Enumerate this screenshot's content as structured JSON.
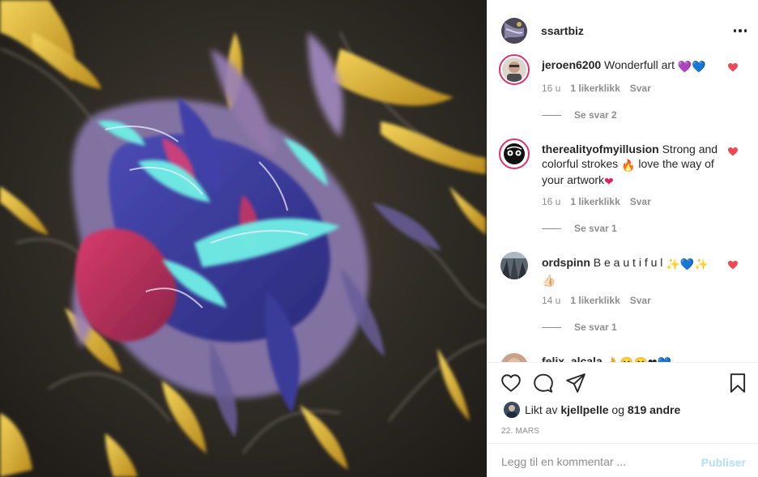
{
  "post": {
    "username": "ssartbiz"
  },
  "comments": [
    {
      "username": "jeroen6200",
      "text": " Wonderfull art ",
      "emojis": "💜💙",
      "time": "16 u",
      "likes": "1 likerklikk",
      "reply": "Svar",
      "replies_label": "Se svar 2"
    },
    {
      "username": "therealityofmyillusion",
      "text": " Strong and colorful strokes ",
      "emoji_mid": "🔥",
      "text2": " love the way of your artwork",
      "emoji_end": "❤",
      "time": "16 u",
      "likes": "1 likerklikk",
      "reply": "Svar",
      "replies_label": "Se svar 1"
    },
    {
      "username": "ordspinn",
      "text": " B e a u t i f u l ",
      "emojis": "✨💙✨",
      "emoji_line2": "👍🏻",
      "time": "14 u",
      "likes": "1 likerklikk",
      "reply": "Svar",
      "replies_label": "Se svar 1"
    },
    {
      "username": "felix_alcala",
      "emojis": "👌😊😊❤💙"
    }
  ],
  "likes": {
    "prefix": "Likt av ",
    "user": "kjellpelle",
    "middle": " og ",
    "count": "819 andre"
  },
  "date": "22. MARS",
  "comment_box": {
    "placeholder": "Legg til en kommentar ...",
    "publish": "Publiser"
  },
  "icons": {
    "like": "heart-outline-icon",
    "comment": "comment-bubble-icon",
    "share": "paper-plane-icon",
    "save": "bookmark-icon",
    "more": "more-dots-icon",
    "comment_like": "heart-filled-icon"
  },
  "colors": {
    "heart_red": "#ed4956",
    "publish_disabled": "#b2dffc",
    "muted": "#8e8e8e"
  }
}
